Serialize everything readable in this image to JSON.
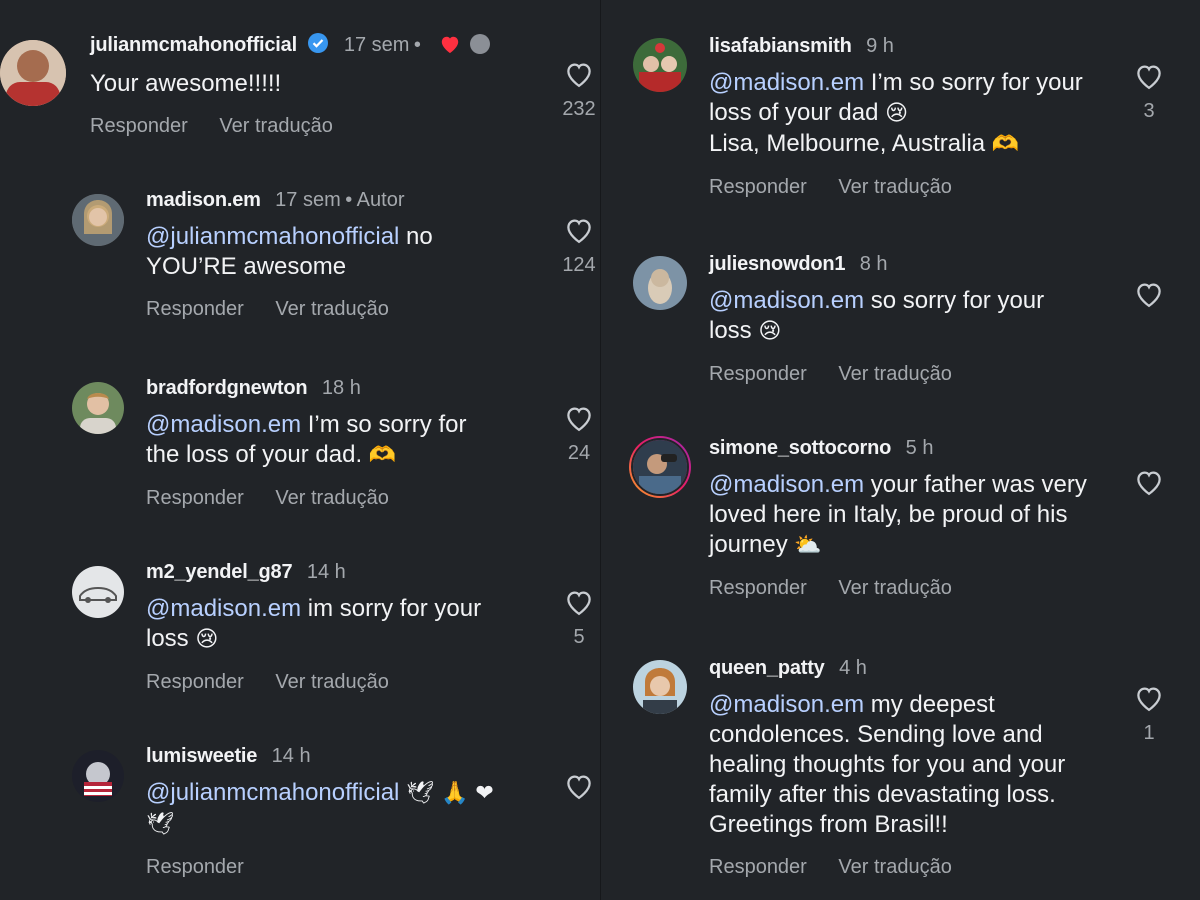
{
  "actions": {
    "reply": "Responder",
    "translate": "Ver tradução"
  },
  "left": [
    {
      "username": "julianmcmahonofficial",
      "time": "17 sem",
      "verified": true,
      "text": "Your awesome!!!!!",
      "likes": "232"
    },
    {
      "username": "madison.em",
      "time": "17 sem",
      "author_label": "Autor",
      "mention": "@julianmcmahonofficial",
      "text": " no YOU’RE awesome",
      "likes": "124"
    },
    {
      "username": "bradfordgnewton",
      "time": "18 h",
      "mention": "@madison.em",
      "text": " I’m so sorry for the loss of your dad.",
      "emoji": "🫶",
      "likes": "24"
    },
    {
      "username": "m2_yendel_g87",
      "time": "14 h",
      "mention": "@madison.em",
      "text": " im sorry for your loss",
      "emoji": "😢",
      "likes": "5"
    },
    {
      "username": "lumisweetie",
      "time": "14 h",
      "mention": "@julianmcmahonofficial",
      "text": "",
      "emoji": "🕊 🙏 ❤ 🕊",
      "likes": ""
    }
  ],
  "right": [
    {
      "username": "lisafabiansmith",
      "time": "9 h",
      "mention": "@madison.em",
      "text": " I’m so sorry for your loss of your dad",
      "emoji": "😢",
      "text2": "Lisa, Melbourne, Australia",
      "emoji2": "🫶",
      "likes": "3"
    },
    {
      "username": "juliesnowdon1",
      "time": "8 h",
      "mention": "@madison.em",
      "text": " so sorry for your loss",
      "emoji": "😢",
      "likes": ""
    },
    {
      "username": "simone_sottocorno",
      "time": "5 h",
      "mention": "@madison.em",
      "text": " your father was very loved here in Italy, be proud of his journey",
      "emoji": "⛅",
      "likes": ""
    },
    {
      "username": "queen_patty",
      "time": "4 h",
      "mention": "@madison.em",
      "text": " my deepest condolences. Sending love and healing thoughts for you and your family after this devastating loss. Greetings from Brasil!!",
      "likes": "1"
    }
  ],
  "colors": {
    "background": "#212428",
    "mention": "#b8d0ff",
    "verified": "#3897f0",
    "heart": "#ff3040"
  }
}
